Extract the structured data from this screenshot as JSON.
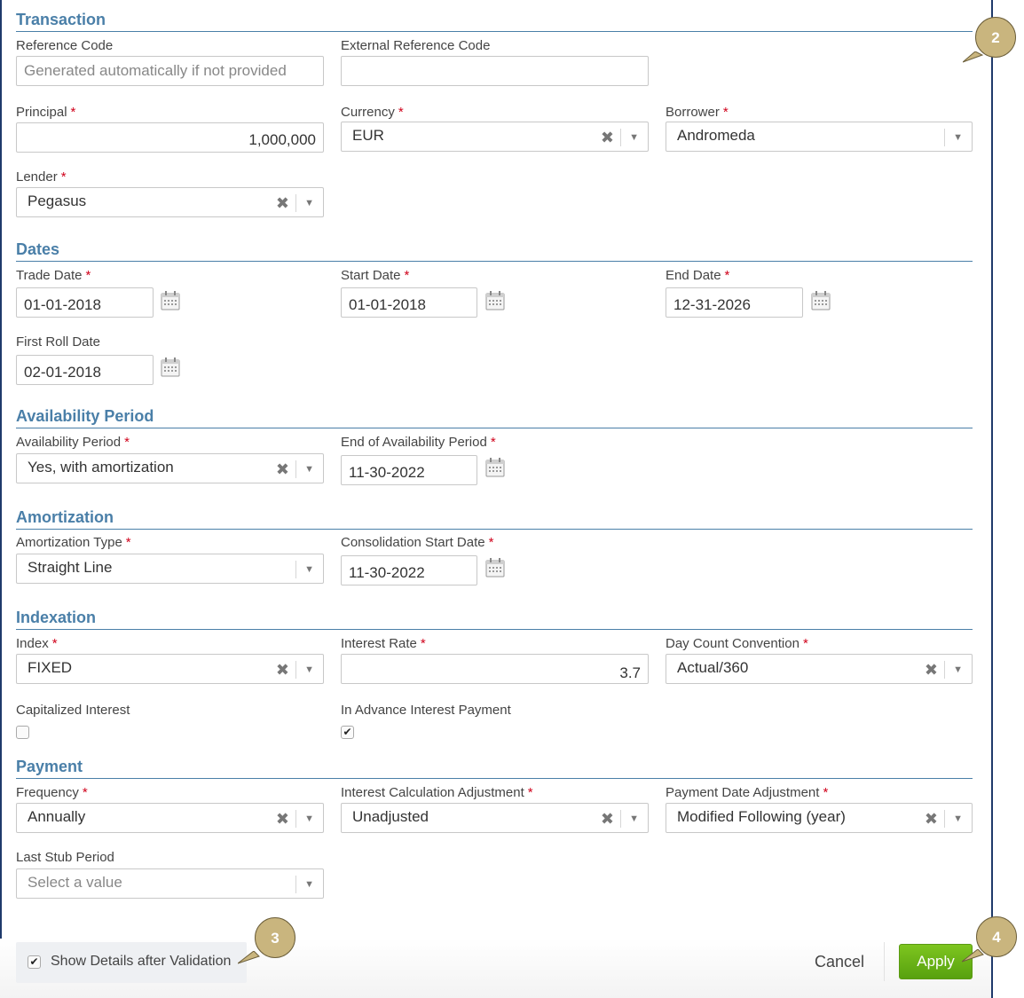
{
  "sections": {
    "transaction": "Transaction",
    "dates": "Dates",
    "availability": "Availability Period",
    "amortization": "Amortization",
    "indexation": "Indexation",
    "payment": "Payment"
  },
  "required_mark": "*",
  "transaction": {
    "reference_code": {
      "label": "Reference Code",
      "placeholder": "Generated automatically if not provided"
    },
    "external_reference_code": {
      "label": "External Reference Code",
      "value": ""
    },
    "principal": {
      "label": "Principal",
      "value": "1,000,000"
    },
    "currency": {
      "label": "Currency",
      "value": "EUR"
    },
    "borrower": {
      "label": "Borrower",
      "value": "Andromeda"
    },
    "lender": {
      "label": "Lender",
      "value": "Pegasus"
    }
  },
  "dates": {
    "trade_date": {
      "label": "Trade Date",
      "value": "01-01-2018"
    },
    "start_date": {
      "label": "Start Date",
      "value": "01-01-2018"
    },
    "end_date": {
      "label": "End Date",
      "value": "12-31-2026"
    },
    "first_roll_date": {
      "label": "First Roll Date",
      "value": "02-01-2018"
    }
  },
  "availability": {
    "period": {
      "label": "Availability Period",
      "value": "Yes, with amortization"
    },
    "end_of_period": {
      "label": "End of Availability Period",
      "value": "11-30-2022"
    }
  },
  "amortization": {
    "type": {
      "label": "Amortization Type",
      "value": "Straight Line"
    },
    "consolidation_start": {
      "label": "Consolidation Start Date",
      "value": "11-30-2022"
    }
  },
  "indexation": {
    "index": {
      "label": "Index",
      "value": "FIXED"
    },
    "interest_rate": {
      "label": "Interest Rate",
      "value": "3.7"
    },
    "day_count": {
      "label": "Day Count Convention",
      "value": "Actual/360"
    },
    "capitalized_interest": {
      "label": "Capitalized Interest",
      "checked": false
    },
    "in_advance_payment": {
      "label": "In Advance Interest Payment",
      "checked": true,
      "mark": "✔"
    }
  },
  "payment": {
    "frequency": {
      "label": "Frequency",
      "value": "Annually"
    },
    "interest_calc_adjustment": {
      "label": "Interest Calculation Adjustment",
      "value": "Unadjusted"
    },
    "payment_date_adjustment": {
      "label": "Payment Date Adjustment",
      "value": "Modified Following (year)"
    },
    "last_stub_period": {
      "label": "Last Stub Period",
      "placeholder": "Select a value"
    }
  },
  "footer": {
    "show_details_label": "Show Details after Validation",
    "show_details_checked": true,
    "check_mark": "✔",
    "cancel_label": "Cancel",
    "apply_label": "Apply"
  },
  "glyphs": {
    "clear": "✖",
    "arrow": "▼"
  },
  "badges": {
    "b2": "2",
    "b3": "3",
    "b4": "4"
  },
  "colors": {
    "section": "#4a7fa8",
    "required": "#d0021b",
    "apply": "#6ab518",
    "badge": "#c9b57e",
    "frame": "#1f3a6b"
  }
}
